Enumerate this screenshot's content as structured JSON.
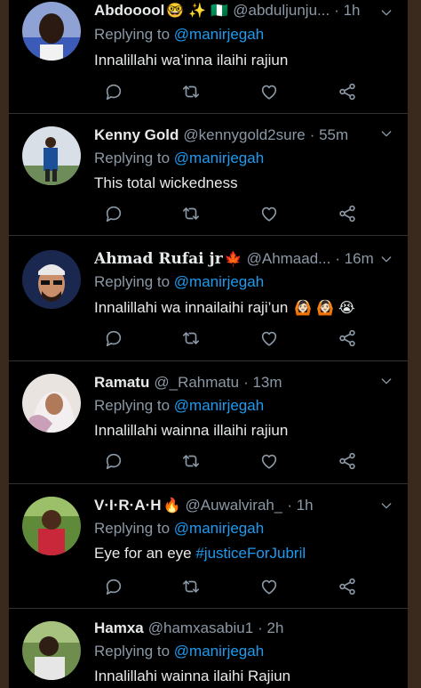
{
  "tweets": [
    {
      "name": "Abdooool",
      "name_emoji": "🤓 ✨ 🇳🇬",
      "handle": "@abduljunju...",
      "time": "· 1h",
      "replying_prefix": "Replying to",
      "replying_to": "@manirjegah",
      "text": "Innalillahi wa’inna ilaihi rajiun"
    },
    {
      "name": "Kenny Gold",
      "handle": "@kennygold2sure",
      "time": "· 55m",
      "replying_prefix": "Replying to",
      "replying_to": "@manirjegah",
      "text": "This total wickedness"
    },
    {
      "name": "Ahmad Rufai jr",
      "name_emoji": "🍁",
      "handle": "@Ahmaad...",
      "time": "· 16m",
      "replying_prefix": "Replying to",
      "replying_to": "@manirjegah",
      "text": "Innalillahi wa innailaihi raji’un",
      "text_emoji": "🙆🏻 🙆🏻 😭"
    },
    {
      "name": "Ramatu",
      "handle": "@_Rahmatu",
      "time": "· 13m",
      "replying_prefix": "Replying to",
      "replying_to": "@manirjegah",
      "text": "Innalillahi wainna illaihi rajiun"
    },
    {
      "name": "V·I·R·A·H",
      "name_emoji": "🔥",
      "handle": "@Auwalvirah_",
      "time": "· 1h",
      "replying_prefix": "Replying to",
      "replying_to": "@manirjegah",
      "text": "Eye for an eye",
      "hashtag": "#justiceForJubril"
    },
    {
      "name": "Hamxa",
      "handle": "@hamxasabiu1",
      "time": "· 2h",
      "replying_prefix": "Replying to",
      "replying_to": "@manirjegah",
      "text": "Innalillahi wainna ilaihi Rajiun"
    }
  ],
  "icons": [
    "reply-icon",
    "retweet-icon",
    "like-icon",
    "share-icon",
    "chevron-down-icon"
  ],
  "colors": {
    "background": "#000000",
    "text": "#e7e9ea",
    "muted": "#8b98a5",
    "link": "#1d9bf0"
  }
}
